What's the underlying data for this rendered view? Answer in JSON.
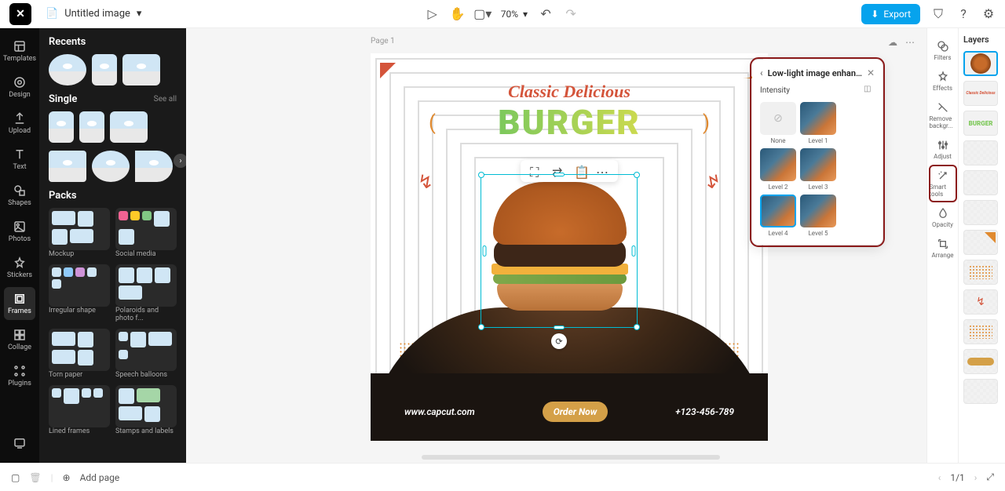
{
  "topbar": {
    "doc_title": "Untitled image",
    "zoom": "70%",
    "export": "Export"
  },
  "leftrail": [
    {
      "label": "Templates"
    },
    {
      "label": "Design"
    },
    {
      "label": "Upload"
    },
    {
      "label": "Text"
    },
    {
      "label": "Shapes"
    },
    {
      "label": "Photos"
    },
    {
      "label": "Stickers"
    },
    {
      "label": "Frames"
    },
    {
      "label": "Collage"
    },
    {
      "label": "Plugins"
    }
  ],
  "leftpanel": {
    "recents": "Recents",
    "single": "Single",
    "see_all": "See all",
    "packs": "Packs",
    "pack_labels": [
      "Mockup",
      "Social media",
      "Irregular shape",
      "Polaroids and photo f...",
      "Torn paper",
      "Speech balloons",
      "Lined frames",
      "Stamps and labels"
    ]
  },
  "canvas": {
    "page_label": "Page 1",
    "title1": "Classic Delicious",
    "title2": "BURGER",
    "website": "www.capcut.com",
    "order": "Order Now",
    "phone": "+123-456-789"
  },
  "bottombar": {
    "add_page": "Add page",
    "page_count": "1/1"
  },
  "rightrail": [
    {
      "label": "Filters"
    },
    {
      "label": "Effects"
    },
    {
      "label": "Remove backgr..."
    },
    {
      "label": "Adjust"
    },
    {
      "label": "Smart tools"
    },
    {
      "label": "Opacity"
    },
    {
      "label": "Arrange"
    }
  ],
  "popup": {
    "title": "Low-light image enhan...",
    "intensity": "Intensity",
    "levels": [
      "None",
      "Level 1",
      "Level 2",
      "Level 3",
      "Level 4",
      "Level 5"
    ]
  },
  "layers": {
    "title": "Layers"
  }
}
